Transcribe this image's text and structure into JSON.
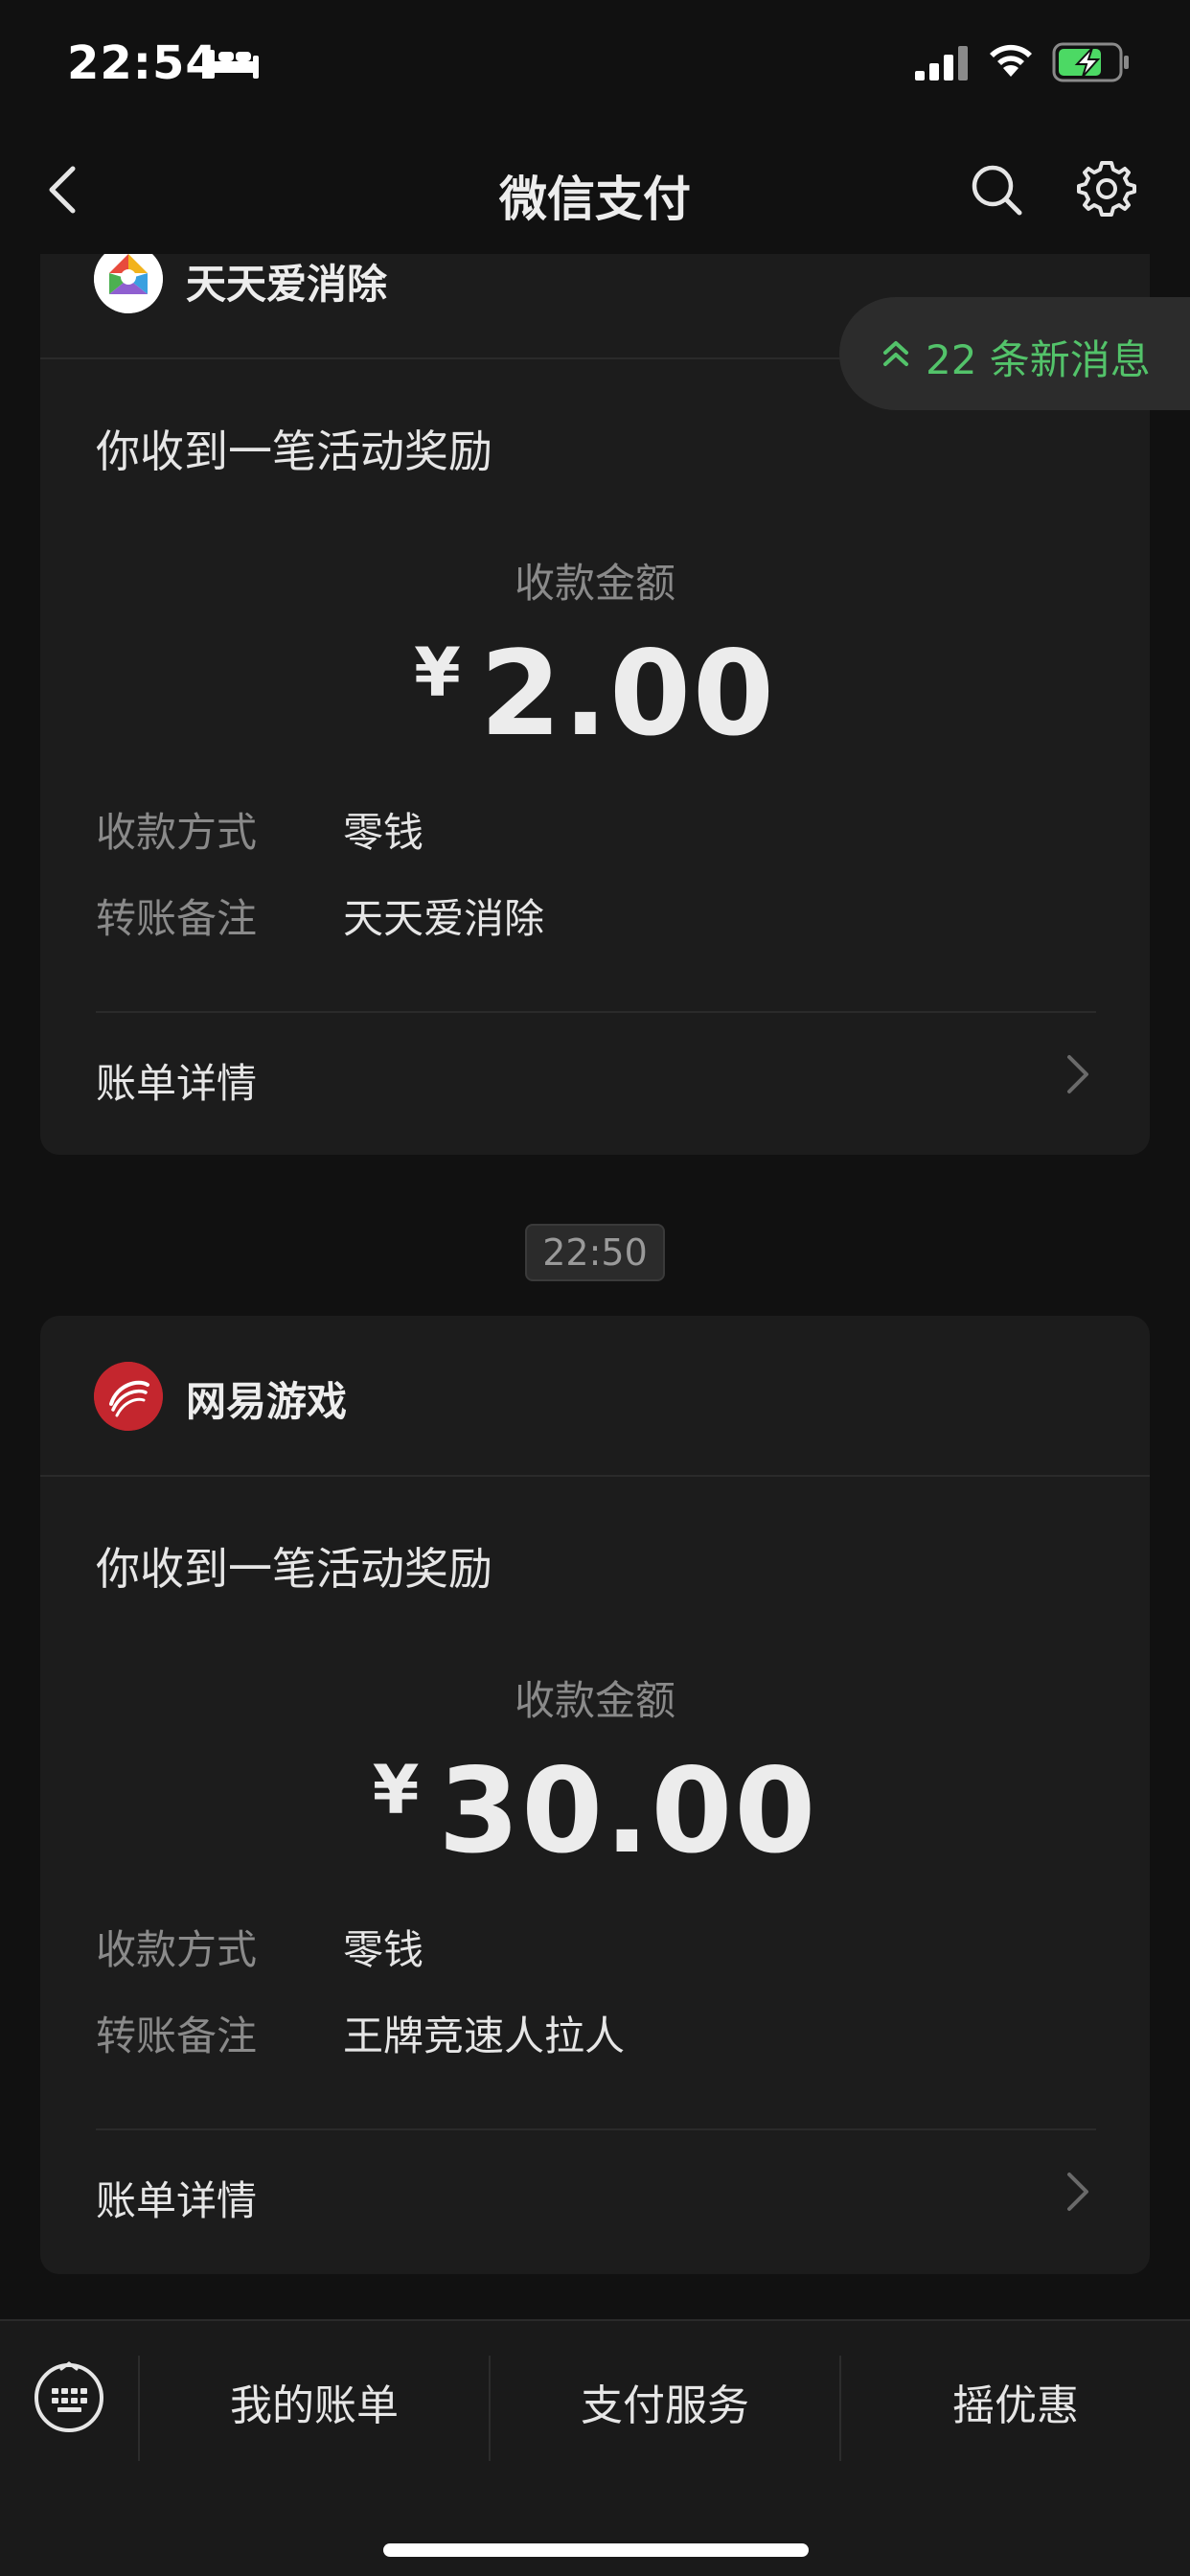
{
  "status_bar": {
    "time": "22:54",
    "battery_color": "#4cd964"
  },
  "nav": {
    "title": "微信支付"
  },
  "new_messages": {
    "label": "22 条新消息",
    "color": "#53c36a"
  },
  "cards": [
    {
      "merchant": "天天爱消除",
      "title": "你收到一笔活动奖励",
      "amount_label": "收款金额",
      "currency": "¥",
      "amount": "2.00",
      "rows": [
        {
          "label": "收款方式",
          "value": "零钱"
        },
        {
          "label": "转账备注",
          "value": "天天爱消除"
        }
      ],
      "detail_label": "账单详情"
    },
    {
      "merchant": "网易游戏",
      "title": "你收到一笔活动奖励",
      "amount_label": "收款金额",
      "currency": "¥",
      "amount": "30.00",
      "rows": [
        {
          "label": "收款方式",
          "value": "零钱"
        },
        {
          "label": "转账备注",
          "value": "王牌竞速人拉人"
        }
      ],
      "detail_label": "账单详情"
    }
  ],
  "timestamp": "22:50",
  "bottom_tabs": [
    {
      "label": "我的账单"
    },
    {
      "label": "支付服务"
    },
    {
      "label": "摇优惠"
    }
  ]
}
